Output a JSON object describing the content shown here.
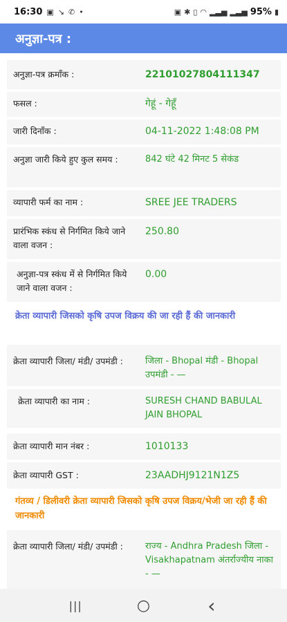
{
  "status_bar": {
    "time": "16:30",
    "battery": "95%"
  },
  "app_bar": {
    "title": "अनुज्ञा-पत्र :"
  },
  "details": {
    "permit_number": {
      "label": "अनुज्ञा-पत्र क्रमाँक :",
      "value": "22101027804111347"
    },
    "crop": {
      "label": "फसल :",
      "value": "गेहूं - गेहूँ"
    },
    "issue_date": {
      "label": "जारी दिनाँक :",
      "value": "04-11-2022  1:48:08 PM"
    },
    "total_time": {
      "label": "अनुज्ञा जारी किये हुए कुल समय :",
      "value": "842 घंटे 42 मिनट 5 सेकंड"
    },
    "trader_firm": {
      "label": "व्यापारी फर्म का नाम :",
      "value": "SREE JEE TRADERS"
    },
    "initial_weight": {
      "label": "प्रारंभिक स्कंध से निर्गमित किये जाने वाला वजन :",
      "value": "250.80"
    },
    "permit_weight": {
      "label": "अनुज्ञा-पत्र स्कंध में से निर्गमित किये जाने वाला वजन :",
      "value": "0.00"
    }
  },
  "buyer_section": {
    "heading": "क्रेता व्यापारी जिसको कृषि उपज विक्रय की जा रही हैं की जानकारी",
    "district": {
      "label": "क्रेता व्यापारी जिला/ मंडी/ उपमंडी :",
      "value": "जिला - Bhopal  मंडी - Bhopal उपमंडी -  —"
    },
    "name": {
      "label": "क्रेता व्यापारी का नाम :",
      "value": "SURESH CHAND BABULAL JAIN BHOPAL"
    },
    "license": {
      "label": "क्रेता व्यापारी मान नंबर :",
      "value": "1010133"
    },
    "gst": {
      "label": "क्रेता व्यापारी GST :",
      "value": "23AADHJ9121N1Z5"
    }
  },
  "destination_section": {
    "heading": "गंतव्य / डिलीवरी क्रेता व्यापारी जिसको कृषि उपज विक्रय/भेजी जा रही हैं की जानकारी",
    "district": {
      "label": "क्रेता व्यापारी जिला/ मंडी/ उपमंडी :",
      "value": "राज्य - Andhra Pradesh जिला - Visakhapatnam अंतर्राज्यीय नाका -  —"
    }
  },
  "nav": {
    "recents": "|||",
    "home": "○",
    "back": "‹"
  },
  "colors": {
    "app_bar": "#5c89e6",
    "value_green": "#2f9e2f",
    "heading_blue": "#5b6bd6",
    "heading_orange": "#f08a00"
  }
}
